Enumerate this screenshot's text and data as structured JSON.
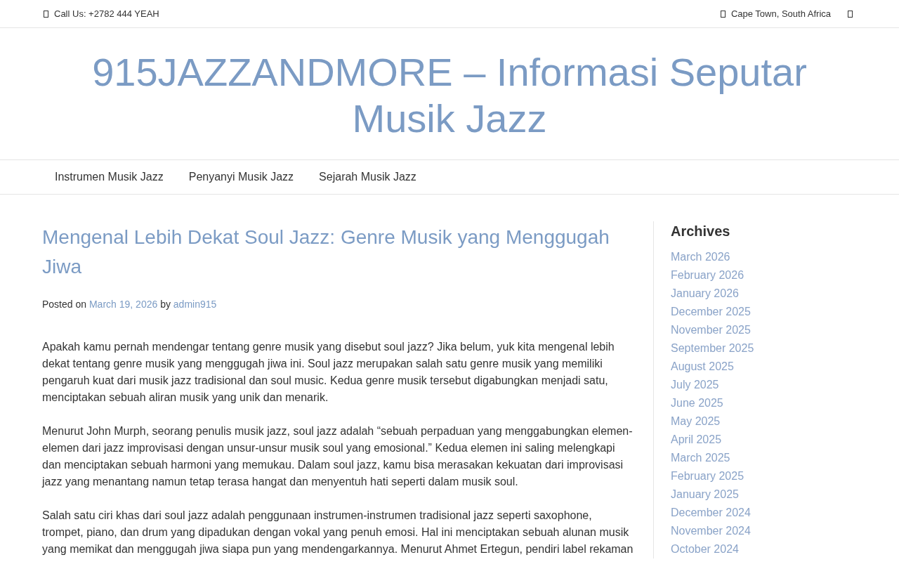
{
  "top_bar": {
    "phone": "Call Us: +2782 444 YEAH",
    "location": "Cape Town, South Africa"
  },
  "site_title": "915JAZZANDMORE – Informasi Seputar Musik Jazz",
  "nav": [
    "Instrumen Musik Jazz",
    "Penyanyi Musik Jazz",
    "Sejarah Musik Jazz"
  ],
  "post": {
    "title": "Mengenal Lebih Dekat Soul Jazz: Genre Musik yang Menggugah Jiwa",
    "posted_on": "Posted on",
    "date": "March 19, 2026",
    "by": "by",
    "author": "admin915",
    "paragraphs": [
      "Apakah kamu pernah mendengar tentang genre musik yang disebut soul jazz? Jika belum, yuk kita mengenal lebih dekat tentang genre musik yang menggugah jiwa ini. Soul jazz merupakan salah satu genre musik yang memiliki pengaruh kuat dari musik jazz tradisional dan soul music. Kedua genre musik tersebut digabungkan menjadi satu, menciptakan sebuah aliran musik yang unik dan menarik.",
      "Menurut John Murph, seorang penulis musik jazz, soul jazz adalah “sebuah perpaduan yang menggabungkan elemen-elemen dari jazz improvisasi dengan unsur-unsur musik soul yang emosional.” Kedua elemen ini saling melengkapi dan menciptakan sebuah harmoni yang memukau. Dalam soul jazz, kamu bisa merasakan kekuatan dari improvisasi jazz yang menantang namun tetap terasa hangat dan menyentuh hati seperti dalam musik soul.",
      "Salah satu ciri khas dari soul jazz adalah penggunaan instrumen-instrumen tradisional jazz seperti saxophone, trompet, piano, dan drum yang dipadukan dengan vokal yang penuh emosi. Hal ini menciptakan sebuah alunan musik yang memikat dan menggugah jiwa siapa pun yang mendengarkannya. Menurut Ahmet Ertegun, pendiri label rekaman"
    ]
  },
  "sidebar": {
    "title": "Archives",
    "items": [
      "March 2026",
      "February 2026",
      "January 2026",
      "December 2025",
      "November 2025",
      "September 2025",
      "August 2025",
      "July 2025",
      "June 2025",
      "May 2025",
      "April 2025",
      "March 2025",
      "February 2025",
      "January 2025",
      "December 2024",
      "November 2024",
      "October 2024"
    ]
  }
}
